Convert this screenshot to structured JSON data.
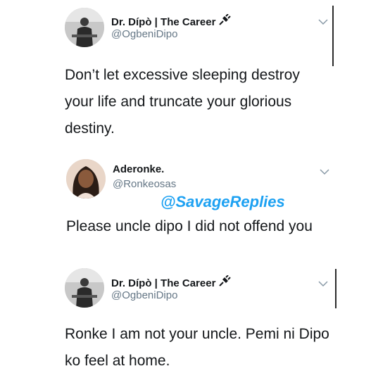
{
  "tweets": [
    {
      "name": "Dr. Dípò | The Career",
      "handle": "@OgbeniDipo",
      "text": "Don’t let excessive sleeping destroy your life and truncate your glorious destiny.",
      "badge_icon": "plug-icon"
    },
    {
      "name": "Aderonke.",
      "handle": "@Ronkeosas",
      "text": "Please uncle dipo I did not offend you"
    },
    {
      "name": "Dr. Dípò | The Career",
      "handle": "@OgbeniDipo",
      "text": "Ronke I am not your uncle. Pemi ni Dipo ko feel at home.",
      "badge_icon": "plug-icon"
    }
  ],
  "watermark": "@SavageReplies",
  "colors": {
    "text": "#14171a",
    "secondary": "#657786",
    "watermark": "#1da1f2"
  }
}
